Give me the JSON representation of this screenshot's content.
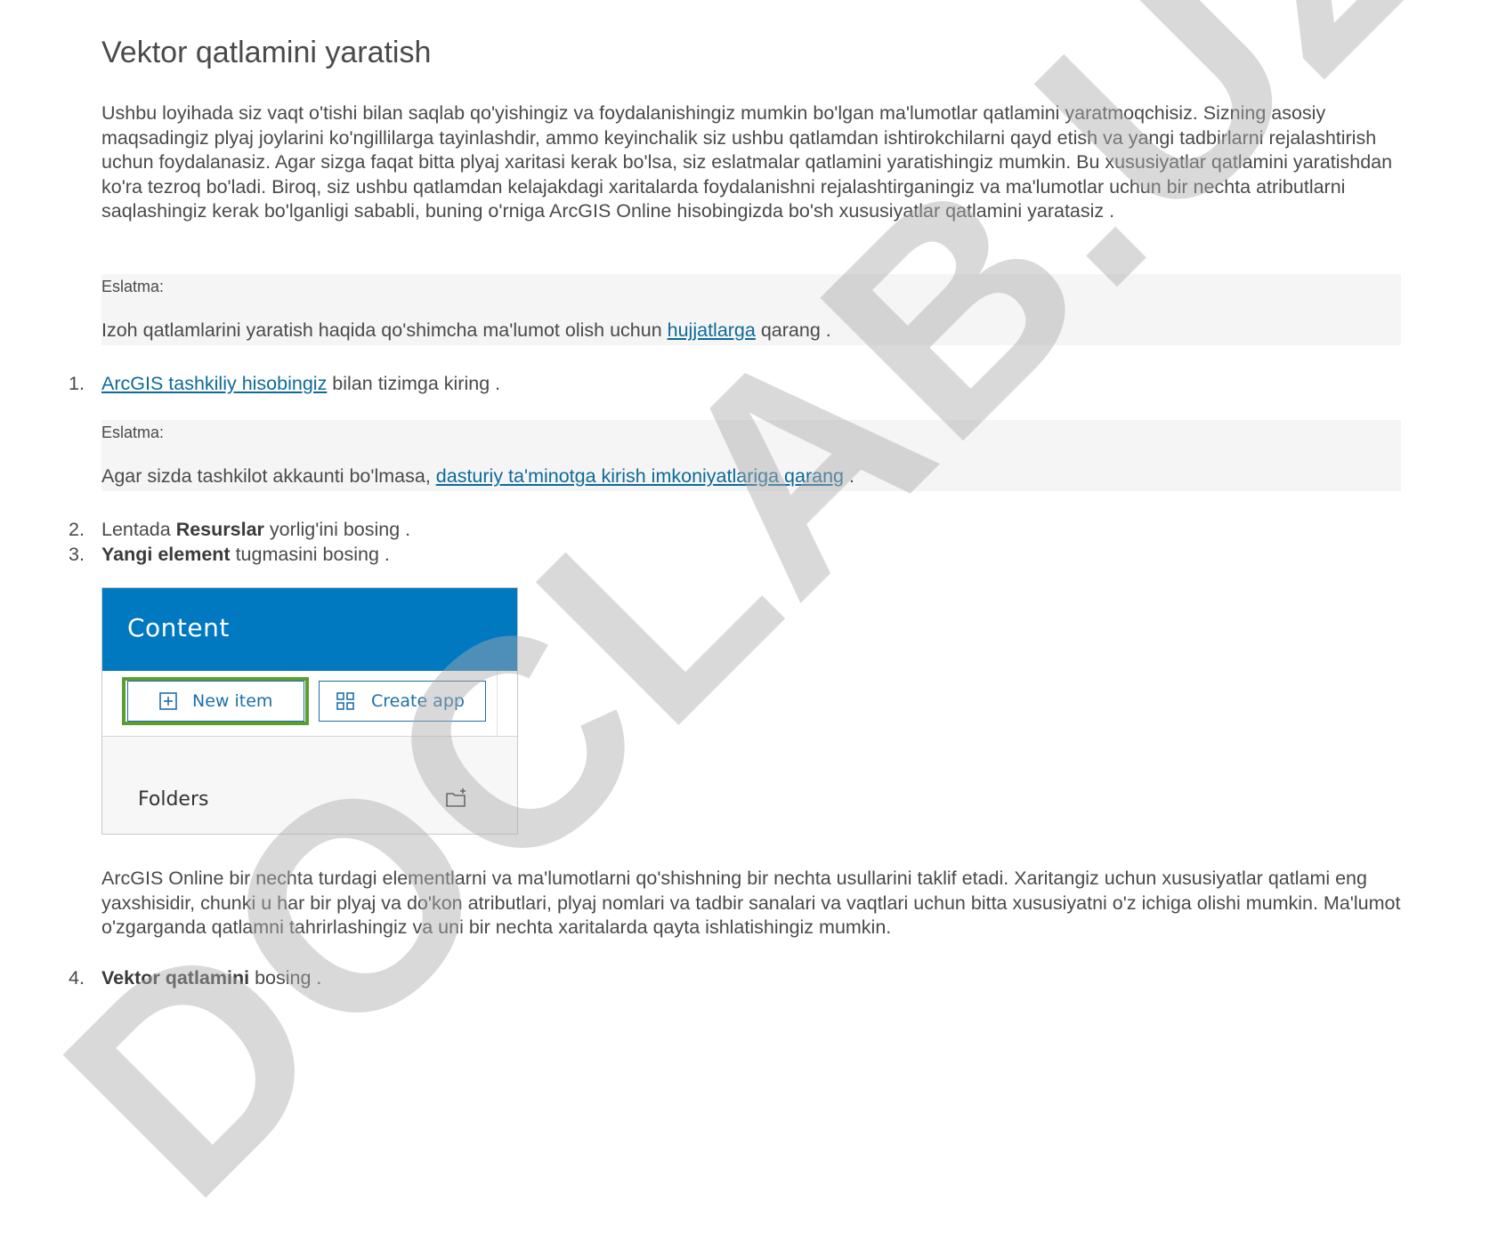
{
  "heading": "Vektor qatlamini yaratish",
  "intro": "Ushbu loyihada siz vaqt o'tishi bilan saqlab qo'yishingiz va foydalanishingiz mumkin bo'lgan ma'lumotlar qatlamini yaratmoqchisiz. Sizning asosiy maqsadingiz plyaj joylarini ko'ngillilarga tayinlashdir, ammo keyinchalik siz ushbu qatlamdan ishtirokchilarni qayd etish va yangi tadbirlarni rejalashtirish uchun foydalanasiz. Agar sizga faqat bitta plyaj xaritasi kerak bo'lsa, siz eslatmalar qatlamini yaratishingiz mumkin. Bu xususiyatlar qatlamini yaratishdan ko'ra tezroq bo'ladi. Biroq, siz ushbu qatlamdan kelajakdagi xaritalarda foydalanishni rejalashtirganingiz va ma'lumotlar uchun bir nechta atributlarni saqlashingiz kerak bo'lganligi sababli, buning o'rniga ArcGIS Online hisobingizda bo'sh xususiyatlar qatlamini yaratasiz .",
  "note1": {
    "label": "Eslatma:",
    "before": "Izoh qatlamlarini yaratish haqida qo'shimcha ma'lumot olish uchun ",
    "link": "hujjatlarga",
    "after": " qarang ."
  },
  "step1": {
    "num": "1.",
    "link": "ArcGIS tashkiliy hisobingiz",
    "after": " bilan tizimga kiring ."
  },
  "note2": {
    "label": "Eslatma:",
    "before": "Agar sizda tashkilot akkaunti bo'lmasa, ",
    "link": "dasturiy ta'minotga kirish imkoniyatlariga qarang",
    "after": " ."
  },
  "step2": {
    "num": "2.",
    "before": "Lentada ",
    "bold": "Resurslar",
    "after": " yorlig'ini bosing ."
  },
  "step3": {
    "num": "3.",
    "bold": "Yangi element",
    "after": " tugmasini bosing ."
  },
  "screenshot": {
    "title": "Content",
    "new_item": "New item",
    "create_app": "Create app",
    "folders": "Folders",
    "header_color": "#0079c1",
    "highlight_color": "#5a9e30"
  },
  "para2": "ArcGIS Online bir nechta turdagi elementlarni va ma'lumotlarni qo'shishning bir nechta usullarini taklif etadi. Xaritangiz uchun xususiyatlar qatlami eng yaxshisidir, chunki u har bir plyaj va do'kon atributlari, plyaj nomlari va tadbir sanalari va vaqtlari uchun bitta xususiyatni o'z ichiga olishi mumkin. Ma'lumot o'zgarganda qatlamni tahrirlashingiz va uni bir nechta xaritalarda qayta ishlatishingiz mumkin.",
  "step4": {
    "num": "4.",
    "bold": "Vektor qatlamini",
    "after": " bosing ."
  },
  "watermark": "DOCLAB.UZ"
}
